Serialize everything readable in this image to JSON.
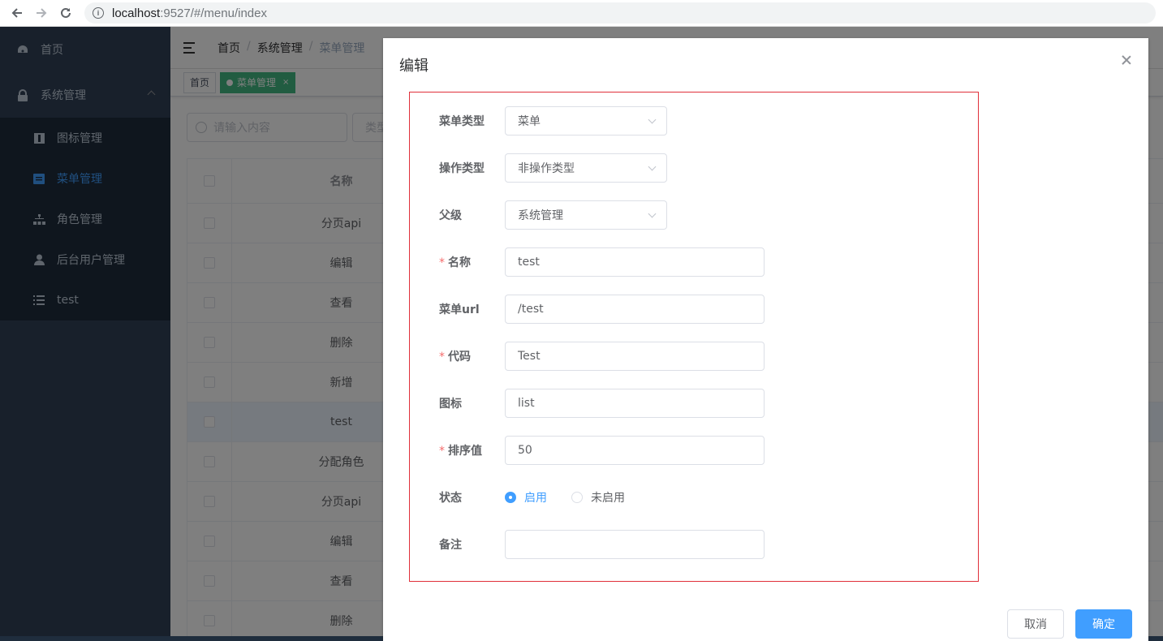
{
  "browser": {
    "url_host": "localhost",
    "url_path": ":9527/#/menu/index"
  },
  "sidebar": {
    "items": [
      {
        "label": "首页",
        "icon": "dashboard-icon"
      },
      {
        "label": "系统管理",
        "icon": "lock-icon"
      }
    ],
    "submenu": [
      {
        "label": "图标管理",
        "icon": "icon-icon"
      },
      {
        "label": "菜单管理",
        "icon": "document-icon",
        "active": true
      },
      {
        "label": "角色管理",
        "icon": "tree-icon"
      },
      {
        "label": "后台用户管理",
        "icon": "user-icon"
      },
      {
        "label": "test",
        "icon": "list-icon"
      }
    ]
  },
  "navbar": {
    "breadcrumb": [
      "首页",
      "系统管理",
      "菜单管理"
    ]
  },
  "tags": {
    "home": "首页",
    "active": "菜单管理",
    "active_close": "×"
  },
  "filter": {
    "search_placeholder": "请输入内容",
    "type_placeholder": "类型"
  },
  "table": {
    "header": "名称",
    "rows": [
      "分页api",
      "编辑",
      "查看",
      "删除",
      "新增",
      "test",
      "分配角色",
      "分页api",
      "编辑",
      "查看",
      "删除"
    ]
  },
  "dialog": {
    "title": "编辑",
    "fields": {
      "menu_type": {
        "label": "菜单类型",
        "value": "菜单"
      },
      "op_type": {
        "label": "操作类型",
        "value": "非操作类型"
      },
      "parent": {
        "label": "父级",
        "value": "系统管理"
      },
      "name": {
        "label": "名称",
        "value": "test",
        "required": "*"
      },
      "url": {
        "label": "菜单url",
        "value": "/test"
      },
      "code": {
        "label": "代码",
        "value": "Test",
        "required": "*"
      },
      "icon": {
        "label": "图标",
        "value": "list"
      },
      "sort": {
        "label": "排序值",
        "value": "50",
        "required": "*"
      },
      "status": {
        "label": "状态",
        "options": [
          "启用",
          "未启用"
        ],
        "selected": "启用"
      },
      "remark": {
        "label": "备注",
        "value": ""
      }
    },
    "cancel_label": "取消",
    "ok_label": "确定"
  },
  "colors": {
    "sidebar_bg": "#304156",
    "primary": "#409eff",
    "tag_active": "#42b983",
    "highlight_border": "#e0303a"
  }
}
